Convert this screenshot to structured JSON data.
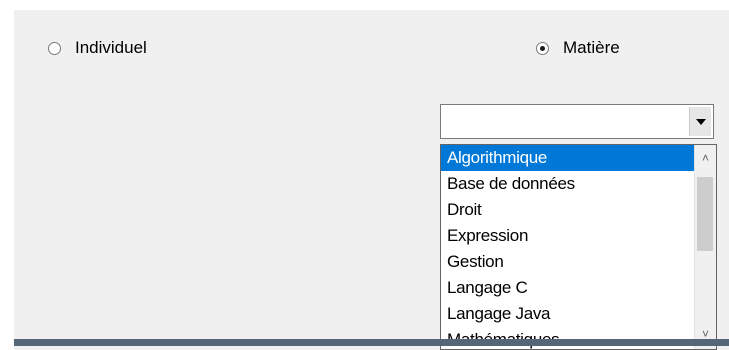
{
  "radios": {
    "individuel": {
      "label": "Individuel",
      "checked": false
    },
    "matiere": {
      "label": "Matière",
      "checked": true
    }
  },
  "combo": {
    "value": "",
    "options": [
      "Algorithmique",
      "Base de données",
      "Droit",
      "Expression",
      "Gestion",
      "Langage C",
      "Langage Java",
      "Mathématiques"
    ],
    "selected_index": 0,
    "icons": {
      "dropdown": "chevron-down-icon",
      "scroll_up": "chevron-up-icon",
      "scroll_down": "chevron-down-icon"
    }
  }
}
